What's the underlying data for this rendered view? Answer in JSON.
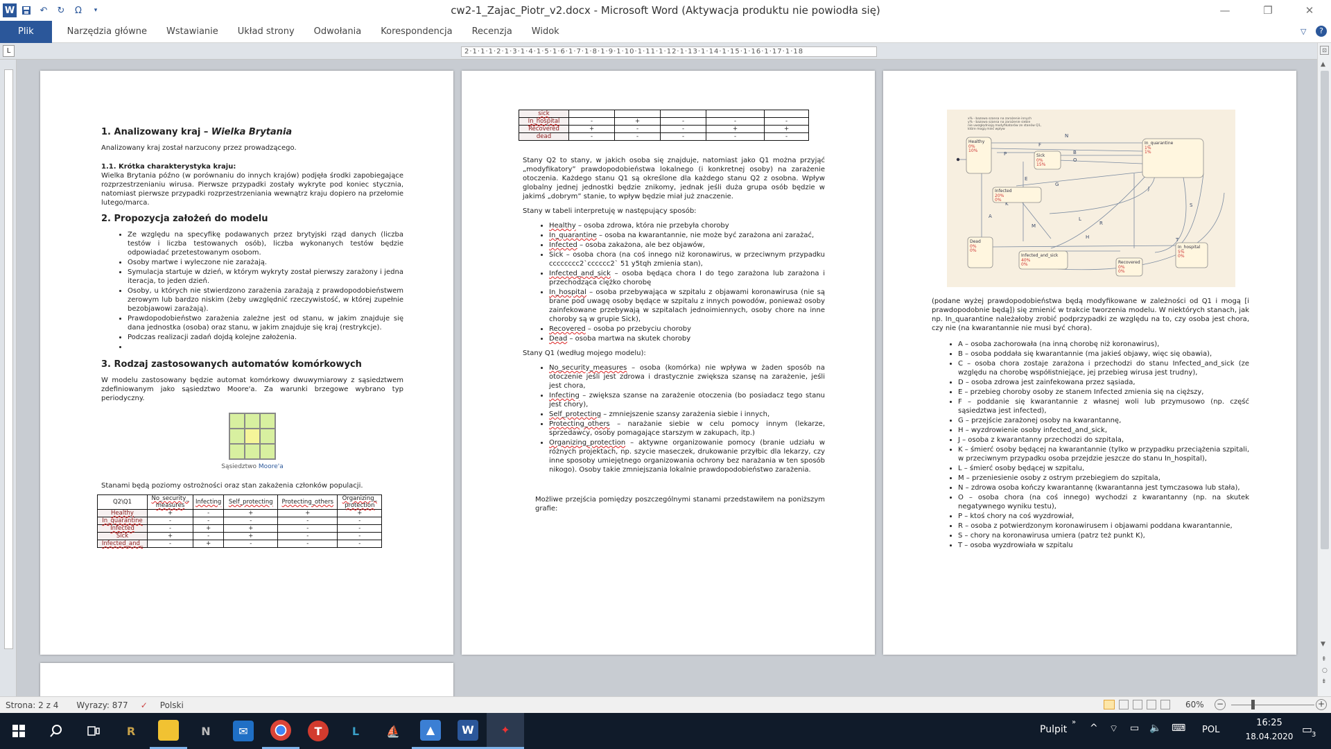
{
  "window": {
    "title": "cw2-1_Zajac_Piotr_v2.docx - Microsoft Word (Aktywacja produktu nie powiodła się)"
  },
  "ribbon": {
    "tabs": [
      "Plik",
      "Narzędzia główne",
      "Wstawianie",
      "Układ strony",
      "Odwołania",
      "Korespondencja",
      "Recenzja",
      "Widok"
    ]
  },
  "ruler": {
    "text": "2·1·1·1·2·1·3·1·4·1·5·1·6·1·7·1·8·1·9·1·10·1·11·1·12·1·13·1·14·1·15·1·16·1·17·1·18"
  },
  "page1": {
    "h1": "1. Analizowany kraj – ",
    "h1_em": "Wielka Brytania",
    "p1": "Analizowany kraj został narzucony przez prowadzącego.",
    "h11": "1.1. Krótka charakterystyka kraju:",
    "p2": "Wielka Brytania późno (w porównaniu do innych krajów) podjęła środki zapobiegające rozprzestrzenianiu wirusa. Pierwsze przypadki zostały wykryte pod koniec stycznia, natomiast pierwsze przypadki rozprzestrzeniania wewnątrz kraju dopiero na przełomie lutego/marca.",
    "h2": "2. Propozycja założeń do modelu",
    "bullets": [
      "Ze względu na specyfikę podawanych przez brytyjski rząd danych (liczba testów i liczba testowanych osób), liczba wykonanych testów będzie odpowiadać przetestowanym osobom.",
      "Osoby martwe i wyleczone nie zarażają.",
      "Symulacja startuje w dzień, w którym wykryty został pierwszy zarażony i jedna iteracja, to jeden dzień.",
      "Osoby, u których nie stwierdzono zarażenia zarażają z prawdopodobieństwem zerowym lub bardzo niskim (żeby uwzględnić rzeczywistość, w której zupełnie bezobjawowi zarażają).",
      "Prawdopodobieństwo zarażenia zależne jest od stanu, w jakim znajduje się dana jednostka (osoba) oraz stanu, w jakim znajduje się kraj (restrykcje).",
      "Podczas realizacji zadań dojdą kolejne założenia.",
      ""
    ],
    "h3": "3. Rodzaj zastosowanych automatów komórkowych",
    "p3": "W modelu zastosowany będzie automat komórkowy dwuwymiarowy z sąsiedztwem zdefiniowanym jako sąsiedztwo Moore'a. Za warunki brzegowe wybrano typ periodyczny.",
    "caption_a": "Sąsiedztwo ",
    "caption_b": "Moore'a",
    "p4": "Stanami będą poziomy ostrożności oraz stan zakażenia członków populacji.",
    "table": {
      "header": [
        "Q2\\Q1",
        "No_security_ measures",
        "Infecting",
        "Self_protecting",
        "Protecting_others",
        "Organizing_ protection"
      ],
      "rows": [
        [
          "Healthy",
          "+",
          "-",
          "+",
          "+",
          "+"
        ],
        [
          "In_quarantine",
          "-",
          "-",
          "-",
          "-",
          "-"
        ],
        [
          "Infected",
          "-",
          "+",
          "+",
          "-",
          "-"
        ],
        [
          "Sick",
          "+",
          "-",
          "+",
          "-",
          "-"
        ],
        [
          "Infected_and_",
          "-",
          "+",
          "-",
          "-",
          "-"
        ]
      ]
    }
  },
  "page2": {
    "table": {
      "rows": [
        [
          "sick",
          "",
          "",
          "",
          "",
          ""
        ],
        [
          "In_hospital",
          "-",
          "+",
          "-",
          "-",
          "-"
        ],
        [
          "Recovered",
          "+",
          "-",
          "-",
          "+",
          "+"
        ],
        [
          "dead",
          "-",
          "-",
          "-",
          "-",
          "-"
        ]
      ]
    },
    "p1": "Stany Q2 to stany, w jakich osoba się znajduje, natomiast jako Q1 można przyjąć „modyfikatory” prawdopodobieństwa lokalnego (i konkretnej osoby) na zarażenie otoczenia. Każdego stanu Q1 są określone dla każdego stanu Q2 z osobna. Wpływ globalny jednej jednostki będzie znikomy, jednak jeśli duża grupa osób będzie w jakimś „dobrym” stanie, to wpływ będzie miał już znaczenie.",
    "p2": "Stany w tabeli interpretuję w następujący sposób:",
    "list1": [
      {
        "term": "Healthy",
        "text": " – osoba zdrowa, która nie przebyła choroby"
      },
      {
        "term": "In_quarantine",
        "text": " – osoba na kwarantannie, nie może być zarażona ani zarażać,"
      },
      {
        "term": "Infected",
        "text": " – osoba zakażona, ale bez objawów,"
      },
      {
        "term": "Sick",
        "text": " – osoba chora (na coś innego niż koronawirus, w przeciwnym przypadku cccccccc2`cccccc2` 51 y5tqh zmienia stan),"
      },
      {
        "term": "Infected_and_sick",
        "text": " – osoba będąca chora I do tego zarażona lub zarażona i przechodząca ciężko chorobę"
      },
      {
        "term": "In_hospital",
        "text": " – osoba przebywająca w szpitalu z objawami koronawirusa (nie są brane pod uwagę osoby będące w szpitalu z innych powodów, ponieważ osoby zainfekowane przebywają w szpitalach jednoimiennych, osoby chore na inne choroby są w grupie Sick),"
      },
      {
        "term": "Recovered",
        "text": " – osoba po przebyciu choroby"
      },
      {
        "term": "Dead",
        "text": " – osoba martwa na skutek choroby"
      }
    ],
    "p3": "Stany Q1 (według mojego modelu):",
    "list2": [
      {
        "term": "No_security_measures",
        "text": " – osoba (komórka) nie wpływa w żaden sposób na otoczenie jeśli jest zdrowa i drastycznie zwiększa szansę na zarażenie, jeśli jest chora,"
      },
      {
        "term": "Infecting",
        "text": " – zwiększa szanse na zarażenie otoczenia (bo posiadacz tego stanu jest chory),"
      },
      {
        "term": "Self_protecting",
        "text": " – zmniejszenie szansy zarażenia siebie i innych,"
      },
      {
        "term": "Protecting_others",
        "text": " – narażanie siebie w celu pomocy innym (lekarze, sprzedawcy, osoby pomagające starszym w zakupach, itp.)"
      },
      {
        "term": "Organizing_protection",
        "text": " – aktywne organizowanie pomocy (branie udziału w różnych projektach, np. szycie maseczek, drukowanie przyłbic dla lekarzy, czy inne sposoby umiejętnego organizowania ochrony bez narażania w ten sposób nikogo). Osoby takie zmniejszania lokalnie prawdopodobieństwo zarażenia."
      }
    ],
    "p4": "Możliwe przejścia pomiędzy poszczególnymi stanami przedstawiłem na poniższym grafie:"
  },
  "page3": {
    "diagram": {
      "notes": [
        "x% - bazowa szansa na zarażenie innych",
        "y% - bazowa szansa na zarażenie siebie",
        "nie uwzględniają modyfikatorów ze stanów Q1,",
        "które mogą mieć wpływ"
      ],
      "states": [
        {
          "name": "Healthy",
          "pct": [
            "0%",
            "10%"
          ]
        },
        {
          "name": "In_quarantine",
          "pct": [
            "1%",
            "1%"
          ]
        },
        {
          "name": "Sick",
          "pct": [
            "0%",
            "15%"
          ]
        },
        {
          "name": "Infected",
          "pct": [
            "20%",
            "0%"
          ]
        },
        {
          "name": "Dead",
          "pct": [
            "0%",
            "0%"
          ]
        },
        {
          "name": "Infected_and_sick",
          "pct": [
            "40%",
            "0%"
          ]
        },
        {
          "name": "Recovered",
          "pct": [
            "0%",
            "0%"
          ]
        },
        {
          "name": "In_hospital",
          "pct": [
            "5%",
            "0%"
          ]
        }
      ],
      "edges": [
        "N",
        "F",
        "P",
        "B",
        "O",
        "C",
        "E",
        "G",
        "K",
        "J",
        "L",
        "A",
        "H",
        "R",
        "T",
        "S",
        "M"
      ]
    },
    "p1": "(podane wyżej prawdopodobieństwa będą modyfikowane w zależności od Q1 i mogą [i prawdopodobnie będą]) się zmienić w trakcie tworzenia modelu. W niektórych stanach, jak np. In_quarantine należałoby zrobić podprzypadki ze względu na to, czy osoba jest chora, czy nie (na kwarantannie nie musi być chora).",
    "list": [
      "A – osoba zachorowała (na inną chorobę niż koronawirus),",
      "B – osoba poddała się kwarantannie (ma jakieś objawy, więc się obawia),",
      "C – osoba chora zostaje zarażona i przechodzi do stanu Infected_and_sick (ze względu na chorobę współistniejące, jej przebieg wirusa jest trudny),",
      "D – osoba zdrowa jest zainfekowana przez sąsiada,",
      "E – przebieg choroby osoby ze stanem Infected zmienia się na cięższy,",
      "F – poddanie się kwarantannie z własnej woli lub przymusowo (np. część sąsiedztwa jest infected),",
      "G – przejście zarażonej osoby na kwarantannę,",
      "H – wyzdrowienie osoby infected_and_sick,",
      "J – osoba z kwarantanny przechodzi do szpitala,",
      "K – śmierć osoby będącej na kwarantannie (tylko w przypadku przeciążenia szpitali, w przeciwnym przypadku osoba przejdzie jeszcze do stanu In_hospital),",
      "L – śmierć osoby będącej w szpitalu,",
      "M – przeniesienie osoby z ostrym przebiegiem do szpitala,",
      "N – zdrowa osoba kończy kwarantannę (kwarantanna jest tymczasowa lub stała),",
      "O – osoba chora (na coś innego) wychodzi z kwarantanny (np. na skutek negatywnego wyniku testu),",
      "P – ktoś chory na coś wyzdrowiał,",
      "R – osoba z potwierdzonym koronawirusem i objawami poddana kwarantannie,",
      "S – chory na koronawirusa umiera (patrz też punkt K),",
      "T – osoba wyzdrowiała w szpitalu"
    ]
  },
  "status": {
    "page": "Strona: 2 z 4",
    "words": "Wyrazy: 877",
    "lang": "Polski",
    "zoom": "60%"
  },
  "taskbar": {
    "desktop": "Pulpit",
    "lang": "POL",
    "time": "16:25",
    "date": "18.04.2020",
    "notif": "3"
  },
  "colors": {
    "accent": "#2b579a",
    "taskbar": "#101b2a",
    "diagram_bg": "#f7efe0",
    "state_fill": "#fff6df",
    "moore_grid": "#d8f0a0",
    "moore_center": "#f5f599"
  },
  "icons": [
    "word-logo",
    "save-icon",
    "undo-icon",
    "redo-icon",
    "omega-icon",
    "customize-icon",
    "minimize-icon",
    "restore-icon",
    "close-icon",
    "help-icon",
    "windows-start-icon",
    "search-icon",
    "task-view-icon",
    "riot-icon",
    "file-explorer-icon",
    "notion-icon",
    "mail-icon",
    "chrome-icon",
    "todoist-icon",
    "league-icon",
    "sailboat-icon",
    "photos-icon",
    "word-taskbar-icon",
    "lol-icon",
    "wifi-icon",
    "battery-icon",
    "volume-icon",
    "keyboard-icon",
    "notification-icon"
  ]
}
